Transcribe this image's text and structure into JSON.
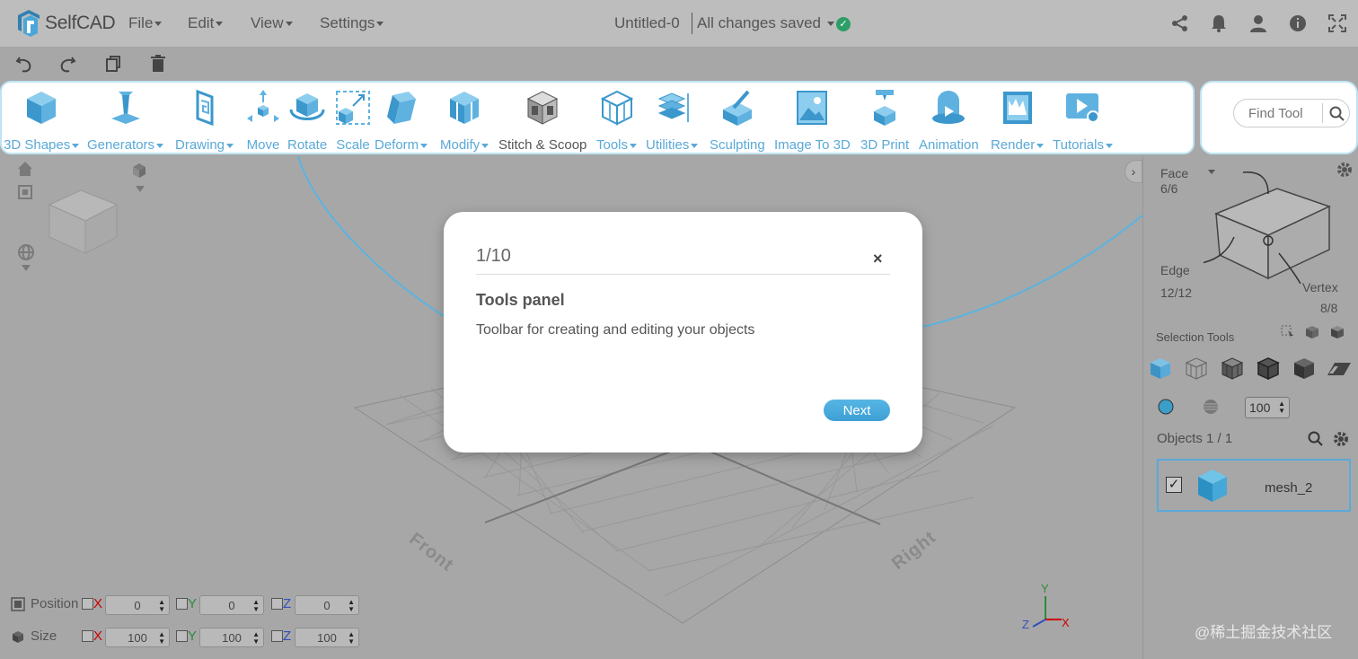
{
  "app": {
    "name": "SelfCAD"
  },
  "menu": [
    "File",
    "Edit",
    "View",
    "Settings"
  ],
  "document": {
    "title": "Untitled-0",
    "status": "All changes saved"
  },
  "tools": [
    {
      "label": "3D Shapes",
      "dropdown": true
    },
    {
      "label": "Generators",
      "dropdown": true
    },
    {
      "label": "Drawing",
      "dropdown": true
    },
    {
      "label": "Move",
      "dropdown": false
    },
    {
      "label": "Rotate",
      "dropdown": false
    },
    {
      "label": "Scale",
      "dropdown": false
    },
    {
      "label": "Deform",
      "dropdown": true
    },
    {
      "label": "Modify",
      "dropdown": true
    },
    {
      "label": "Stitch & Scoop",
      "dropdown": false
    },
    {
      "label": "Tools",
      "dropdown": true
    },
    {
      "label": "Utilities",
      "dropdown": true
    },
    {
      "label": "Sculpting",
      "dropdown": false
    },
    {
      "label": "Image To 3D",
      "dropdown": false
    },
    {
      "label": "3D Print",
      "dropdown": false
    },
    {
      "label": "Animation",
      "dropdown": false
    },
    {
      "label": "Render",
      "dropdown": true
    },
    {
      "label": "Tutorials",
      "dropdown": true
    }
  ],
  "find_tool": {
    "placeholder": "Find Tool"
  },
  "tour": {
    "step": "1/10",
    "close": "×",
    "title": "Tools panel",
    "text": "Toolbar for creating and editing your objects",
    "next": "Next"
  },
  "selection": {
    "face_label": "Face",
    "face_count": "6/6",
    "edge_label": "Edge",
    "edge_count": "12/12",
    "vertex_label": "Vertex",
    "vertex_count": "8/8",
    "tools_label": "Selection Tools",
    "brush_value": "100"
  },
  "objects": {
    "header": "Objects 1 / 1",
    "items": [
      {
        "name": "mesh_2",
        "checked": true
      }
    ]
  },
  "transform": {
    "position_label": "Position",
    "size_label": "Size",
    "axes": [
      "X",
      "Y",
      "Z"
    ],
    "position": [
      "0",
      "0",
      "0"
    ],
    "size": [
      "100",
      "100",
      "100"
    ]
  },
  "viewport": {
    "front_label": "Front",
    "right_label": "Right"
  },
  "gizmo_axes": {
    "y": "Y",
    "x": "X",
    "z": "Z"
  },
  "watermark": "@稀土掘金技术社区",
  "colors": {
    "accent": "#5aa9d8",
    "check": "#2e9e67",
    "highlight_border": "#bfe3f4"
  }
}
